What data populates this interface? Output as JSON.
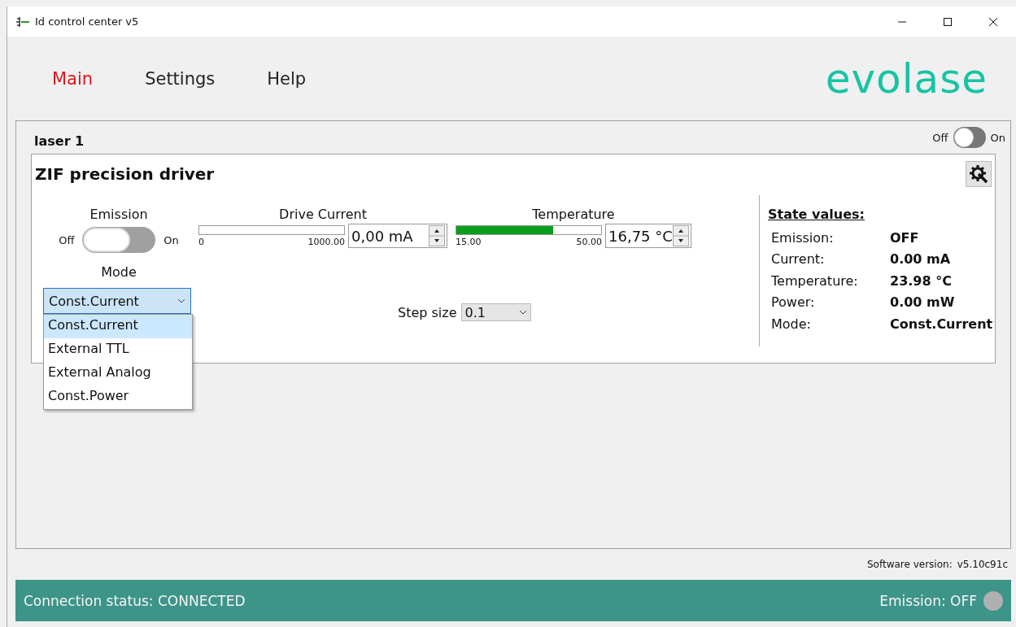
{
  "window": {
    "title": "Id control center v5"
  },
  "nav": [
    {
      "label": "Main",
      "selected": true
    },
    {
      "label": "Settings",
      "selected": false
    },
    {
      "label": "Help",
      "selected": false
    }
  ],
  "logo": "evolase",
  "laser_panel": {
    "title": "laser 1",
    "toggle": {
      "off_label": "Off",
      "on_label": "On",
      "on": false
    },
    "driver": {
      "title": "ZIF precision driver",
      "emission": {
        "label": "Emission",
        "off_label": "Off",
        "on_label": "On",
        "on": false
      },
      "mode": {
        "label": "Mode",
        "value": "Const.Current",
        "expanded": true,
        "options": [
          {
            "label": "Const.Current",
            "selected": true
          },
          {
            "label": "External TTL",
            "selected": false
          },
          {
            "label": "External Analog",
            "selected": false
          },
          {
            "label": "Const.Power",
            "selected": false
          }
        ]
      },
      "drive_current": {
        "label": "Drive Current",
        "min": "0",
        "max": "1000.00",
        "value": "0,00 mA"
      },
      "temperature": {
        "label": "Temperature",
        "level": 0.67,
        "min": "15.00",
        "max": "50.00",
        "value": "16,75 °C"
      },
      "step_size": {
        "label": "Step size",
        "value": "0.1"
      },
      "state_values": {
        "title": "State values:",
        "rows": [
          {
            "label": "Emission:",
            "value": "OFF"
          },
          {
            "label": "Current:",
            "value": "0.00 mA"
          },
          {
            "label": "Temperature:",
            "value": "23.98 °C"
          },
          {
            "label": "Power:",
            "value": "0.00 mW"
          },
          {
            "label": "Mode:",
            "value": "Const.Current"
          }
        ]
      }
    }
  },
  "software_version": {
    "label": "Software version:",
    "value": "v5.10c91c"
  },
  "status_bar": {
    "connection": "Connection status: CONNECTED",
    "emission": "Emission: OFF",
    "emission_on": false
  }
}
